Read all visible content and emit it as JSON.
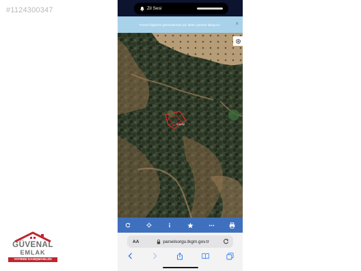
{
  "listing": {
    "id_label": "#1124300347"
  },
  "status_bar": {
    "island_label": "Zil Sesi"
  },
  "banner": {
    "text": "Parsel bilgilerini görüntülemek için lütfen parsele tıklayınız.",
    "close_label": "×"
  },
  "map": {
    "parcel_label": "1/1432",
    "accent": "#e02a2a"
  },
  "toolbar": {
    "color": "#3f70be",
    "icons": [
      "refresh-icon",
      "locate-icon",
      "info-icon",
      "star-icon",
      "more-icon",
      "print-icon"
    ]
  },
  "browser": {
    "aa_label": "AA",
    "url": "parselsorgu.tkgm.gov.tr",
    "nav_icons": [
      "back-icon",
      "forward-icon",
      "share-icon",
      "bookmarks-icon",
      "tabs-icon"
    ]
  },
  "logo": {
    "line1": "GÜVENAL",
    "line2": "EMLAK",
    "line3": "YATIRIM DANIŞMANLIĞI",
    "brand_red": "#c0262e"
  }
}
